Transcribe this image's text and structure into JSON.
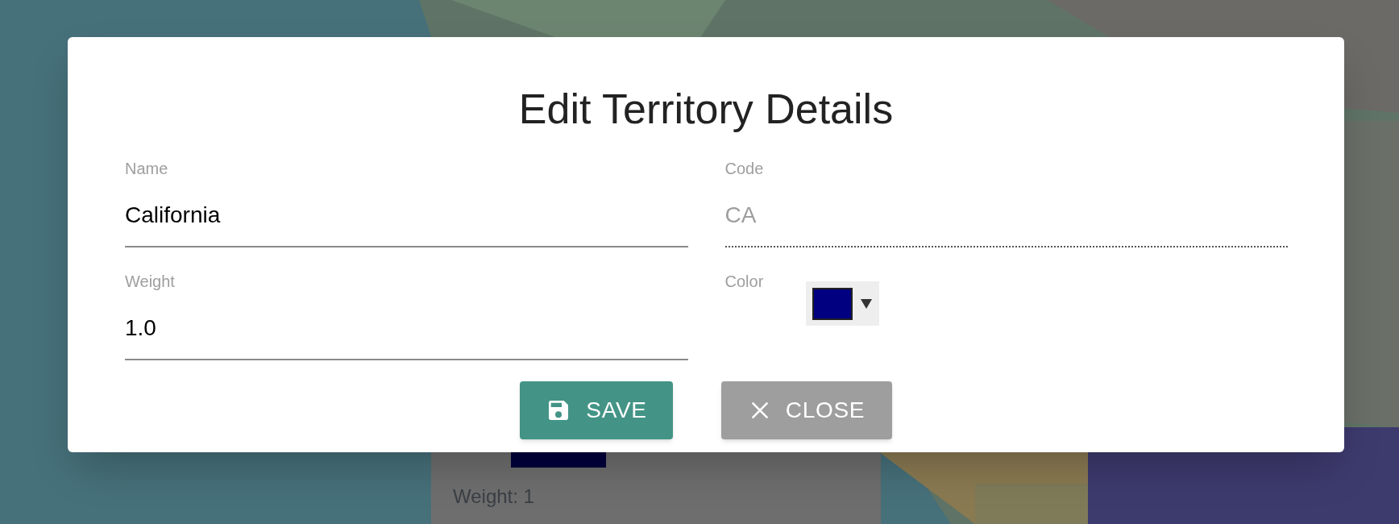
{
  "dialog": {
    "title": "Edit Territory Details",
    "fields": [
      {
        "kind": "text",
        "label": "Name",
        "value": "California",
        "disabled": false
      },
      {
        "kind": "text",
        "label": "Code",
        "value": "CA",
        "disabled": true
      },
      {
        "kind": "text",
        "label": "Weight",
        "value": "1.0",
        "disabled": false
      },
      {
        "kind": "color",
        "label": "Color",
        "color": "#000080"
      }
    ],
    "buttons": [
      {
        "kind": "save",
        "label": "SAVE"
      },
      {
        "kind": "close",
        "label": "CLOSE"
      }
    ]
  },
  "popup": {
    "swatch": {
      "color": "#00003c"
    },
    "weight": "Weight: 1"
  }
}
